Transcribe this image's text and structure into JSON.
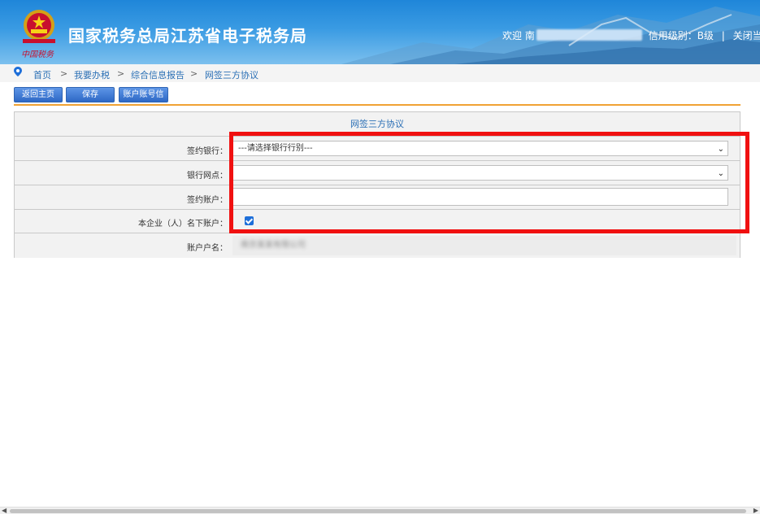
{
  "header": {
    "title": "国家税务总局江苏省电子税务局",
    "slogan": "中国税务",
    "welcome": "欢迎",
    "user_initial": "南",
    "credit_label": "信用级别：",
    "credit_value": "B级",
    "close_label": "关闭当页"
  },
  "breadcrumb": {
    "items": [
      "首页",
      "我要办税",
      "综合信息报告",
      "网签三方协议"
    ],
    "separator": ">"
  },
  "toolbar": {
    "home_label": "返回主页",
    "save_label": "保存",
    "account_info_label": "账户账号信息"
  },
  "form": {
    "title": "网签三方协议",
    "bank_label": "签约银行：",
    "bank_value": "---请选择银行行别---",
    "branch_label": "银行网点：",
    "branch_value": "",
    "account_label": "签约账户：",
    "account_value": "",
    "own_account_label": "本企业（人）名下账户：",
    "own_account_checked": true,
    "account_name_label": "账户户名：",
    "account_name_value": "南京某某有限公司"
  },
  "colors": {
    "accent_orange": "#f0a234",
    "button_blue": "#2e68c6",
    "link_blue": "#2a6fb5",
    "highlight_red": "#f01010"
  }
}
